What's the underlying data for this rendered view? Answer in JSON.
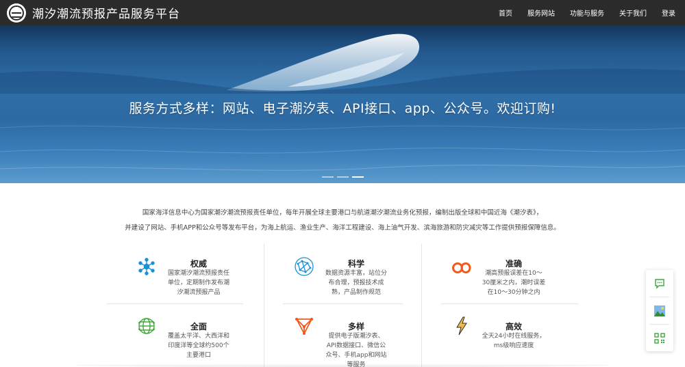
{
  "header": {
    "site_title": "潮汐潮流预报产品服务平台",
    "logo_icon": "logo-emblem-icon",
    "nav": [
      {
        "label": "首页"
      },
      {
        "label": "服务网站"
      },
      {
        "label": "功能与服务"
      },
      {
        "label": "关于我们"
      },
      {
        "label": "登录"
      }
    ]
  },
  "hero": {
    "headline": "服务方式多样：网站、电子潮汐表、API接口、app、公众号。欢迎订购!",
    "slides": 3,
    "active_slide": 3
  },
  "intro": {
    "line1": "国家海洋信息中心为国家潮汐潮流预报责任单位，每年开展全球主要港口与航道潮汐潮流业务化预报，编制出版全球和中国近海《潮汐表》，",
    "line2": "并建设了网站、手机APP和公众号等发布平台，为海上航运、渔业生产、海洋工程建设、海上油气开发、滨海旅游和防灾减灾等工作提供预报保障信息。"
  },
  "features": [
    {
      "title": "权威",
      "desc": "国家潮汐潮流预报责任单位，定期制作发布潮汐潮流预报产品",
      "icon": "network-nodes-icon",
      "color": "#1b8fd8"
    },
    {
      "title": "科学",
      "desc": "数据资源丰富，站位分布合理，预报技术成熟，产品制作规范",
      "icon": "globe-network-icon",
      "color": "#1b8fd8"
    },
    {
      "title": "准确",
      "desc": "潮高预报误差在10～30厘米之内，潮时误差在10～30分钟之内",
      "icon": "infinity-loop-icon",
      "color": "#f05a1e"
    },
    {
      "title": "全面",
      "desc": "覆盖太平洋、大西洋和印度洋等全球约500个主要港口",
      "icon": "globe-icon",
      "color": "#43a83a"
    },
    {
      "title": "多样",
      "desc": "提供电子版潮汐表、API数据接口、微信公众号、手机app和网站等服务",
      "icon": "triangle-network-icon",
      "color": "#f05a1e"
    },
    {
      "title": "高效",
      "desc": "全天24小时在线服务，ms级响应速度",
      "icon": "lightning-bolt-icon",
      "color": "#e8a93a"
    }
  ],
  "side_widget": {
    "items": [
      {
        "icon": "chat-bubble-icon",
        "color": "#3aa83a"
      },
      {
        "icon": "image-picture-icon",
        "color": "#2f8fd8"
      },
      {
        "icon": "qrcode-icon",
        "color": "#3aa83a"
      }
    ]
  }
}
